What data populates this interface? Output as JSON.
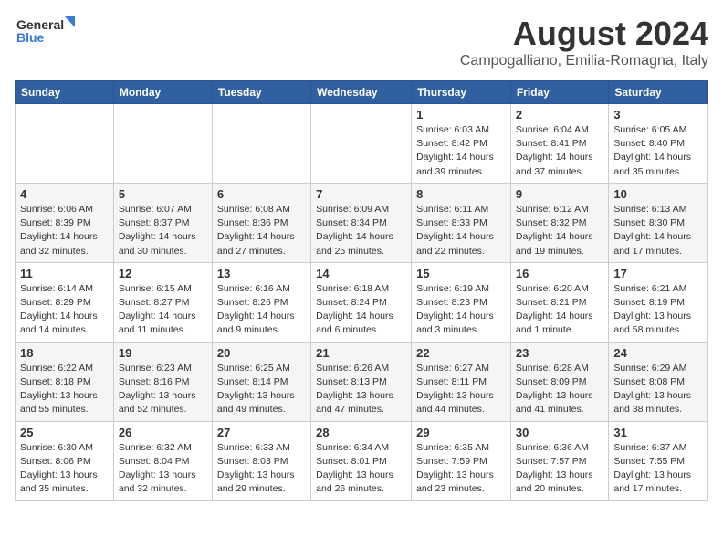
{
  "logo": {
    "line1": "General",
    "line2": "Blue"
  },
  "title": "August 2024",
  "location": "Campogalliano, Emilia-Romagna, Italy",
  "weekdays": [
    "Sunday",
    "Monday",
    "Tuesday",
    "Wednesday",
    "Thursday",
    "Friday",
    "Saturday"
  ],
  "weeks": [
    [
      {
        "day": "",
        "info": ""
      },
      {
        "day": "",
        "info": ""
      },
      {
        "day": "",
        "info": ""
      },
      {
        "day": "",
        "info": ""
      },
      {
        "day": "1",
        "info": "Sunrise: 6:03 AM\nSunset: 8:42 PM\nDaylight: 14 hours\nand 39 minutes."
      },
      {
        "day": "2",
        "info": "Sunrise: 6:04 AM\nSunset: 8:41 PM\nDaylight: 14 hours\nand 37 minutes."
      },
      {
        "day": "3",
        "info": "Sunrise: 6:05 AM\nSunset: 8:40 PM\nDaylight: 14 hours\nand 35 minutes."
      }
    ],
    [
      {
        "day": "4",
        "info": "Sunrise: 6:06 AM\nSunset: 8:39 PM\nDaylight: 14 hours\nand 32 minutes."
      },
      {
        "day": "5",
        "info": "Sunrise: 6:07 AM\nSunset: 8:37 PM\nDaylight: 14 hours\nand 30 minutes."
      },
      {
        "day": "6",
        "info": "Sunrise: 6:08 AM\nSunset: 8:36 PM\nDaylight: 14 hours\nand 27 minutes."
      },
      {
        "day": "7",
        "info": "Sunrise: 6:09 AM\nSunset: 8:34 PM\nDaylight: 14 hours\nand 25 minutes."
      },
      {
        "day": "8",
        "info": "Sunrise: 6:11 AM\nSunset: 8:33 PM\nDaylight: 14 hours\nand 22 minutes."
      },
      {
        "day": "9",
        "info": "Sunrise: 6:12 AM\nSunset: 8:32 PM\nDaylight: 14 hours\nand 19 minutes."
      },
      {
        "day": "10",
        "info": "Sunrise: 6:13 AM\nSunset: 8:30 PM\nDaylight: 14 hours\nand 17 minutes."
      }
    ],
    [
      {
        "day": "11",
        "info": "Sunrise: 6:14 AM\nSunset: 8:29 PM\nDaylight: 14 hours\nand 14 minutes."
      },
      {
        "day": "12",
        "info": "Sunrise: 6:15 AM\nSunset: 8:27 PM\nDaylight: 14 hours\nand 11 minutes."
      },
      {
        "day": "13",
        "info": "Sunrise: 6:16 AM\nSunset: 8:26 PM\nDaylight: 14 hours\nand 9 minutes."
      },
      {
        "day": "14",
        "info": "Sunrise: 6:18 AM\nSunset: 8:24 PM\nDaylight: 14 hours\nand 6 minutes."
      },
      {
        "day": "15",
        "info": "Sunrise: 6:19 AM\nSunset: 8:23 PM\nDaylight: 14 hours\nand 3 minutes."
      },
      {
        "day": "16",
        "info": "Sunrise: 6:20 AM\nSunset: 8:21 PM\nDaylight: 14 hours\nand 1 minute."
      },
      {
        "day": "17",
        "info": "Sunrise: 6:21 AM\nSunset: 8:19 PM\nDaylight: 13 hours\nand 58 minutes."
      }
    ],
    [
      {
        "day": "18",
        "info": "Sunrise: 6:22 AM\nSunset: 8:18 PM\nDaylight: 13 hours\nand 55 minutes."
      },
      {
        "day": "19",
        "info": "Sunrise: 6:23 AM\nSunset: 8:16 PM\nDaylight: 13 hours\nand 52 minutes."
      },
      {
        "day": "20",
        "info": "Sunrise: 6:25 AM\nSunset: 8:14 PM\nDaylight: 13 hours\nand 49 minutes."
      },
      {
        "day": "21",
        "info": "Sunrise: 6:26 AM\nSunset: 8:13 PM\nDaylight: 13 hours\nand 47 minutes."
      },
      {
        "day": "22",
        "info": "Sunrise: 6:27 AM\nSunset: 8:11 PM\nDaylight: 13 hours\nand 44 minutes."
      },
      {
        "day": "23",
        "info": "Sunrise: 6:28 AM\nSunset: 8:09 PM\nDaylight: 13 hours\nand 41 minutes."
      },
      {
        "day": "24",
        "info": "Sunrise: 6:29 AM\nSunset: 8:08 PM\nDaylight: 13 hours\nand 38 minutes."
      }
    ],
    [
      {
        "day": "25",
        "info": "Sunrise: 6:30 AM\nSunset: 8:06 PM\nDaylight: 13 hours\nand 35 minutes."
      },
      {
        "day": "26",
        "info": "Sunrise: 6:32 AM\nSunset: 8:04 PM\nDaylight: 13 hours\nand 32 minutes."
      },
      {
        "day": "27",
        "info": "Sunrise: 6:33 AM\nSunset: 8:03 PM\nDaylight: 13 hours\nand 29 minutes."
      },
      {
        "day": "28",
        "info": "Sunrise: 6:34 AM\nSunset: 8:01 PM\nDaylight: 13 hours\nand 26 minutes."
      },
      {
        "day": "29",
        "info": "Sunrise: 6:35 AM\nSunset: 7:59 PM\nDaylight: 13 hours\nand 23 minutes."
      },
      {
        "day": "30",
        "info": "Sunrise: 6:36 AM\nSunset: 7:57 PM\nDaylight: 13 hours\nand 20 minutes."
      },
      {
        "day": "31",
        "info": "Sunrise: 6:37 AM\nSunset: 7:55 PM\nDaylight: 13 hours\nand 17 minutes."
      }
    ]
  ]
}
